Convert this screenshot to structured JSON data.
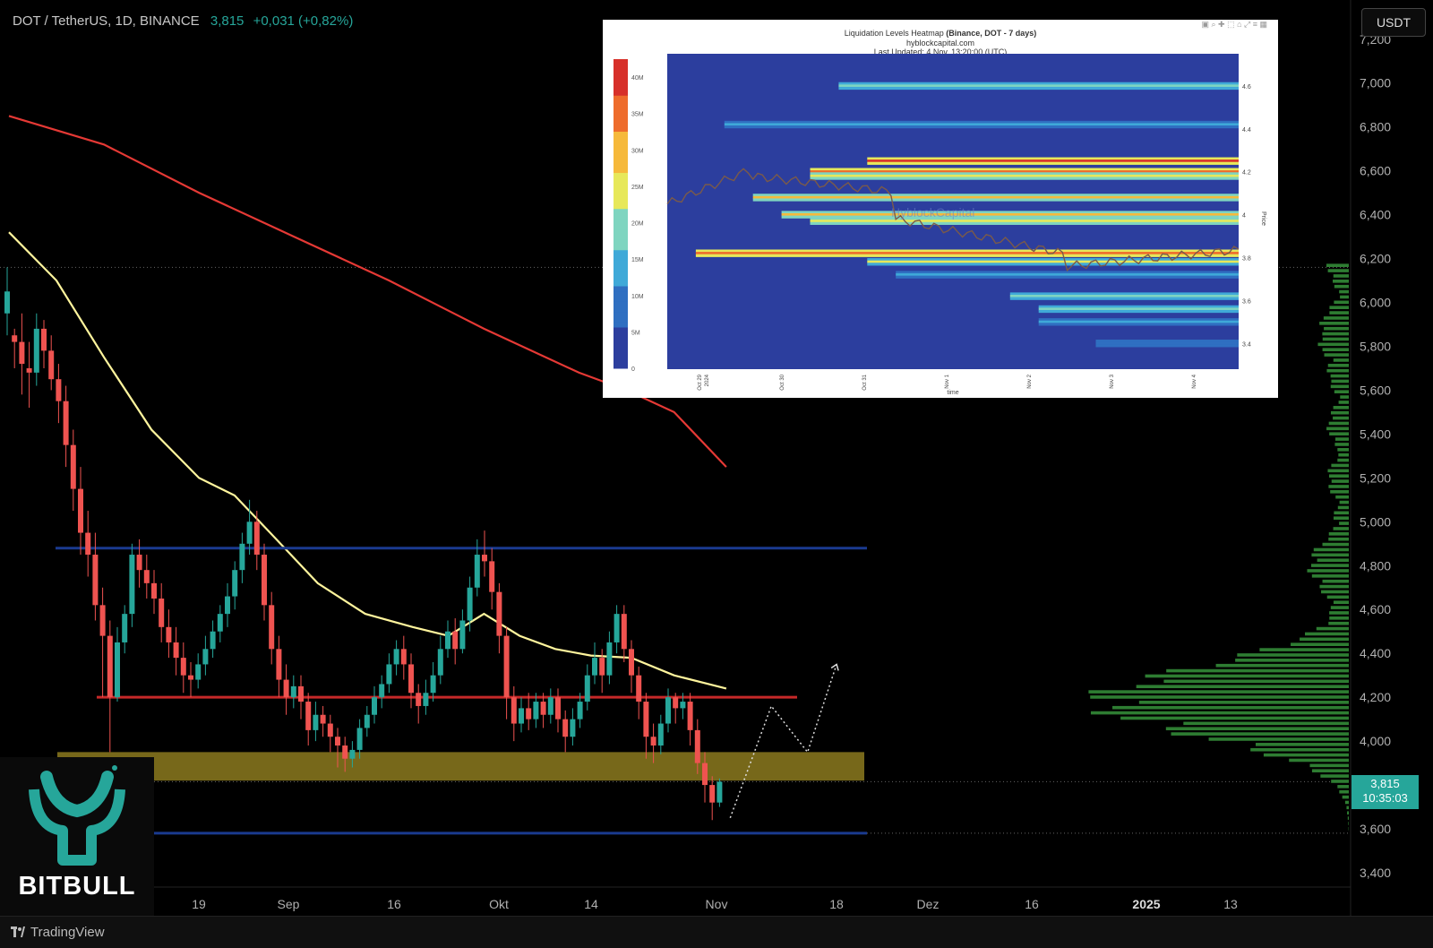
{
  "header": {
    "symbol": "DOT / TetherUS, 1D, BINANCE",
    "price": "3,815",
    "change": "+0,031 (+0,82%)"
  },
  "currency": "USDT",
  "price_tag": {
    "price": "3,815",
    "countdown": "10:35:03"
  },
  "logo": {
    "brand": "BITBULL"
  },
  "footer": {
    "platform": "TradingView"
  },
  "colors": {
    "up": "#26a69a",
    "down": "#ef5350",
    "ma_red": "#e53935",
    "ma_yellow": "#fff59d",
    "support_red": "#c62828",
    "range_blue": "#1a3a8f",
    "zone": "#8c7a1e",
    "volume_profile": "#2e7d32"
  },
  "heatmap": {
    "title": "Liquidation Levels Heatmap",
    "title_bold": "(Binance, DOT - 7 days)",
    "source": "hyblockcapital.com",
    "updated": "Last Updated: 4 Nov, 13:20:00 (UTC)",
    "watermark": "HyblockCapital",
    "colorbar_ticks": [
      "0",
      "5M",
      "10M",
      "15M",
      "20M",
      "25M",
      "30M",
      "35M",
      "40M"
    ],
    "price_ticks": [
      "3.4",
      "3.6",
      "3.8",
      "4",
      "4.2",
      "4.4",
      "4.6"
    ],
    "y_axis_label": "Price",
    "x_ticks": [
      "Oct 29\n2024",
      "Oct 30",
      "Oct 31",
      "Nov 1",
      "Nov 2",
      "Nov 3",
      "Nov 4"
    ],
    "x_axis_label": "time"
  },
  "chart_data": {
    "type": "candlestick",
    "symbol": "DOT / TetherUS",
    "timeframe": "1D",
    "exchange": "BINANCE",
    "y_ticks": [
      "3,400",
      "3,600",
      "3,800",
      "4,000",
      "4,200",
      "4,400",
      "4,600",
      "4,800",
      "5,000",
      "5,200",
      "5,400",
      "5,600",
      "5,800",
      "6,000",
      "6,200",
      "6,400",
      "6,600",
      "6,800",
      "7,000",
      "7,200"
    ],
    "ylim": [
      3.3,
      7.3
    ],
    "x_ticks": [
      "19",
      "Sep",
      "16",
      "Okt",
      "14",
      "Nov",
      "18",
      "Dez",
      "16",
      "2025",
      "13"
    ],
    "last_price": 3.815,
    "levels": {
      "range_top": 4.88,
      "support": 4.2,
      "zone": [
        3.82,
        3.95
      ],
      "range_bottom": 3.58,
      "dotted_high": 6.16
    },
    "moving_averages": [
      {
        "color": "#e53935",
        "points": [
          [
            0,
            6.85
          ],
          [
            40,
            6.72
          ],
          [
            80,
            6.5
          ],
          [
            120,
            6.3
          ],
          [
            160,
            6.1
          ],
          [
            200,
            5.88
          ],
          [
            240,
            5.68
          ],
          [
            260,
            5.6
          ],
          [
            280,
            5.5
          ],
          [
            302,
            5.25
          ]
        ]
      },
      {
        "color": "#fff59d",
        "points": [
          [
            0,
            6.32
          ],
          [
            20,
            6.1
          ],
          [
            40,
            5.75
          ],
          [
            60,
            5.42
          ],
          [
            80,
            5.2
          ],
          [
            95,
            5.12
          ],
          [
            110,
            4.95
          ],
          [
            130,
            4.72
          ],
          [
            150,
            4.58
          ],
          [
            170,
            4.52
          ],
          [
            185,
            4.48
          ],
          [
            200,
            4.58
          ],
          [
            215,
            4.48
          ],
          [
            230,
            4.42
          ],
          [
            245,
            4.39
          ],
          [
            262,
            4.38
          ],
          [
            280,
            4.3
          ],
          [
            302,
            4.24
          ]
        ]
      }
    ],
    "projection": [
      [
        299,
        3.65
      ],
      [
        316,
        4.16
      ],
      [
        331,
        3.95
      ],
      [
        343,
        4.35
      ]
    ],
    "candles": [
      [
        5.95,
        6.05,
        6.16,
        5.85
      ],
      [
        5.85,
        5.82,
        5.88,
        5.7
      ],
      [
        5.82,
        5.72,
        5.95,
        5.58
      ],
      [
        5.7,
        5.68,
        5.82,
        5.52
      ],
      [
        5.68,
        5.88,
        5.95,
        5.62
      ],
      [
        5.88,
        5.78,
        5.92,
        5.7
      ],
      [
        5.78,
        5.65,
        5.85,
        5.6
      ],
      [
        5.65,
        5.55,
        5.72,
        5.45
      ],
      [
        5.55,
        5.35,
        5.62,
        5.25
      ],
      [
        5.35,
        5.15,
        5.42,
        5.05
      ],
      [
        5.15,
        4.95,
        5.25,
        4.85
      ],
      [
        4.95,
        4.85,
        5.05,
        4.75
      ],
      [
        4.85,
        4.62,
        4.95,
        4.55
      ],
      [
        4.62,
        4.48,
        4.7,
        4.2
      ],
      [
        4.48,
        4.2,
        4.55,
        3.95
      ],
      [
        4.2,
        4.45,
        4.52,
        4.18
      ],
      [
        4.45,
        4.58,
        4.62,
        4.4
      ],
      [
        4.58,
        4.85,
        4.9,
        4.52
      ],
      [
        4.85,
        4.78,
        4.92,
        4.7
      ],
      [
        4.78,
        4.72,
        4.85,
        4.65
      ],
      [
        4.72,
        4.65,
        4.78,
        4.58
      ],
      [
        4.65,
        4.52,
        4.72,
        4.45
      ],
      [
        4.52,
        4.45,
        4.6,
        4.38
      ],
      [
        4.45,
        4.38,
        4.52,
        4.3
      ],
      [
        4.38,
        4.3,
        4.45,
        4.22
      ],
      [
        4.3,
        4.28,
        4.36,
        4.2
      ],
      [
        4.28,
        4.35,
        4.4,
        4.24
      ],
      [
        4.35,
        4.42,
        4.48,
        4.3
      ],
      [
        4.42,
        4.5,
        4.55,
        4.38
      ],
      [
        4.5,
        4.58,
        4.62,
        4.45
      ],
      [
        4.58,
        4.66,
        4.72,
        4.52
      ],
      [
        4.66,
        4.78,
        4.82,
        4.6
      ],
      [
        4.78,
        4.9,
        4.95,
        4.72
      ],
      [
        4.9,
        5.0,
        5.1,
        4.85
      ],
      [
        5.0,
        4.85,
        5.05,
        4.78
      ],
      [
        4.85,
        4.62,
        4.9,
        4.55
      ],
      [
        4.62,
        4.42,
        4.68,
        4.35
      ],
      [
        4.42,
        4.28,
        4.48,
        4.2
      ],
      [
        4.28,
        4.2,
        4.35,
        4.12
      ],
      [
        4.2,
        4.25,
        4.3,
        4.15
      ],
      [
        4.25,
        4.18,
        4.3,
        4.1
      ],
      [
        4.18,
        4.05,
        4.22,
        3.98
      ],
      [
        4.05,
        4.12,
        4.18,
        4.0
      ],
      [
        4.12,
        4.08,
        4.16,
        4.02
      ],
      [
        4.08,
        4.02,
        4.12,
        3.95
      ],
      [
        4.02,
        3.98,
        4.06,
        3.88
      ],
      [
        3.98,
        3.92,
        4.02,
        3.86
      ],
      [
        3.92,
        3.96,
        4.0,
        3.88
      ],
      [
        3.96,
        4.06,
        4.1,
        3.92
      ],
      [
        4.06,
        4.12,
        4.16,
        4.02
      ],
      [
        4.12,
        4.2,
        4.25,
        4.08
      ],
      [
        4.2,
        4.26,
        4.3,
        4.15
      ],
      [
        4.26,
        4.35,
        4.4,
        4.22
      ],
      [
        4.35,
        4.42,
        4.46,
        4.3
      ],
      [
        4.42,
        4.35,
        4.48,
        4.28
      ],
      [
        4.35,
        4.22,
        4.4,
        4.15
      ],
      [
        4.22,
        4.16,
        4.26,
        4.08
      ],
      [
        4.16,
        4.22,
        4.28,
        4.12
      ],
      [
        4.22,
        4.3,
        4.36,
        4.18
      ],
      [
        4.3,
        4.42,
        4.48,
        4.26
      ],
      [
        4.42,
        4.5,
        4.55,
        4.38
      ],
      [
        4.5,
        4.42,
        4.56,
        4.35
      ],
      [
        4.42,
        4.55,
        4.6,
        4.4
      ],
      [
        4.55,
        4.7,
        4.75,
        4.5
      ],
      [
        4.7,
        4.85,
        4.92,
        4.66
      ],
      [
        4.85,
        4.82,
        4.96,
        4.75
      ],
      [
        4.82,
        4.68,
        4.88,
        4.6
      ],
      [
        4.68,
        4.48,
        4.72,
        4.4
      ],
      [
        4.48,
        4.2,
        4.52,
        4.1
      ],
      [
        4.2,
        4.08,
        4.25,
        4.0
      ],
      [
        4.08,
        4.15,
        4.2,
        4.04
      ],
      [
        4.15,
        4.1,
        4.22,
        4.05
      ],
      [
        4.1,
        4.18,
        4.22,
        4.06
      ],
      [
        4.18,
        4.12,
        4.22,
        4.06
      ],
      [
        4.12,
        4.2,
        4.24,
        4.08
      ],
      [
        4.2,
        4.1,
        4.24,
        4.04
      ],
      [
        4.1,
        4.02,
        4.14,
        3.95
      ],
      [
        4.02,
        4.1,
        4.15,
        3.98
      ],
      [
        4.1,
        4.18,
        4.22,
        4.06
      ],
      [
        4.18,
        4.3,
        4.35,
        4.14
      ],
      [
        4.3,
        4.38,
        4.45,
        4.26
      ],
      [
        4.38,
        4.3,
        4.42,
        4.22
      ],
      [
        4.3,
        4.45,
        4.5,
        4.26
      ],
      [
        4.45,
        4.58,
        4.62,
        4.4
      ],
      [
        4.58,
        4.42,
        4.62,
        4.36
      ],
      [
        4.42,
        4.3,
        4.46,
        4.22
      ],
      [
        4.3,
        4.18,
        4.34,
        4.1
      ],
      [
        4.18,
        4.02,
        4.22,
        3.92
      ],
      [
        4.02,
        3.98,
        4.08,
        3.9
      ],
      [
        3.98,
        4.08,
        4.12,
        3.94
      ],
      [
        4.08,
        4.2,
        4.24,
        4.04
      ],
      [
        4.2,
        4.15,
        4.22,
        4.08
      ],
      [
        4.15,
        4.18,
        4.22,
        4.1
      ],
      [
        4.18,
        4.05,
        4.22,
        3.98
      ],
      [
        4.05,
        3.9,
        4.1,
        3.85
      ],
      [
        3.9,
        3.8,
        3.95,
        3.72
      ],
      [
        3.8,
        3.72,
        3.84,
        3.64
      ],
      [
        3.72,
        3.815,
        3.83,
        3.7
      ]
    ],
    "volume_profile_range": [
      3.6,
      6.18
    ],
    "volume_profile_peak_price": 4.18
  }
}
